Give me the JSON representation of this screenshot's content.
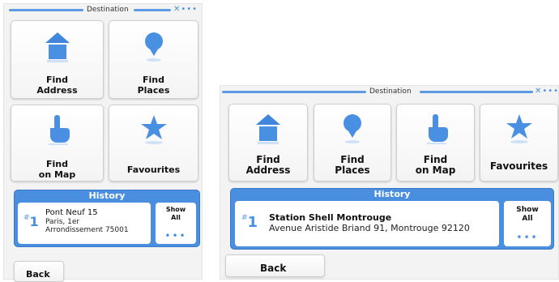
{
  "colors": {
    "accent": "#4a8ee0",
    "icon_blue": "#4a90e2",
    "background": "#f3f3f3"
  },
  "screen_portrait": {
    "title": "Destination",
    "gps_icon": "satellite-signal-icon",
    "tiles": [
      {
        "label": "Find\nAddress",
        "icon": "house-icon"
      },
      {
        "label": "Find\nPlaces",
        "icon": "map-pin-icon"
      },
      {
        "label": "Find\non Map",
        "icon": "pointing-hand-icon"
      },
      {
        "label": "Favourites",
        "icon": "star-icon"
      }
    ],
    "history": {
      "title": "History",
      "item": {
        "rank": "1",
        "name": "Pont Neuf 15",
        "address": "Paris, 1er\nArrondissement 75001"
      },
      "show_all": "Show\nAll",
      "dots": "•••"
    },
    "back": "Back"
  },
  "screen_landscape": {
    "title": "Destination",
    "gps_icon": "satellite-signal-icon",
    "tiles": [
      {
        "label": "Find\nAddress",
        "icon": "house-icon"
      },
      {
        "label": "Find\nPlaces",
        "icon": "map-pin-icon"
      },
      {
        "label": "Find\non Map",
        "icon": "pointing-hand-icon"
      },
      {
        "label": "Favourites",
        "icon": "star-icon"
      }
    ],
    "history": {
      "title": "History",
      "item": {
        "rank": "1",
        "name": "Station Shell Montrouge",
        "address": "Avenue Aristide Briand 91, Montrouge 92120"
      },
      "show_all": "Show\nAll",
      "dots": "•••"
    },
    "back": "Back"
  }
}
